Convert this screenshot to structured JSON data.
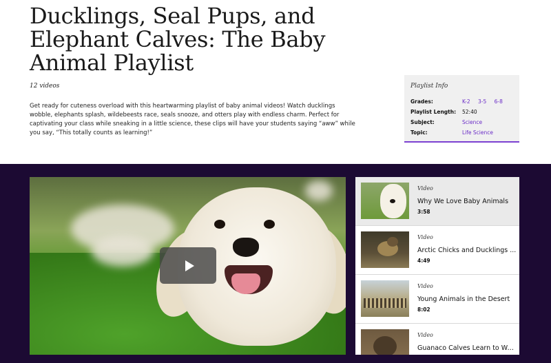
{
  "header": {
    "title": "Ducklings, Seal Pups, and Elephant Calves: The Baby Animal Playlist",
    "video_count": "12 videos",
    "description": "Get ready for cuteness overload with this heartwarming playlist of baby animal videos! Watch ducklings wobble, elephants splash, wildebeests race, seals snooze, and otters play with endless charm. Perfect for captivating your class while sneaking in a little science, these clips will have your students saying “aww” while you say, “This totally counts as learning!”"
  },
  "playlist_info": {
    "title": "Playlist Info",
    "grades_label": "Grades:",
    "grades": [
      "K-2",
      "3-5",
      "6-8"
    ],
    "length_label": "Playlist Length:",
    "length": "52:40",
    "subject_label": "Subject:",
    "subject": "Science",
    "topic_label": "Topic:",
    "topic": "Life Science"
  },
  "player": {
    "play_icon": "play-icon"
  },
  "videos": [
    {
      "kind": "Video",
      "title": "Why We Love Baby Animals",
      "duration": "3:58"
    },
    {
      "kind": "Video",
      "title": "Arctic Chicks and Ducklings ...",
      "duration": "4:49"
    },
    {
      "kind": "Video",
      "title": "Young Animals in the Desert",
      "duration": "8:02"
    },
    {
      "kind": "Video",
      "title": "Guanaco Calves Learn to Walk",
      "duration": ""
    }
  ],
  "colors": {
    "accent": "#6a2cc7",
    "band": "#1c0a33"
  }
}
